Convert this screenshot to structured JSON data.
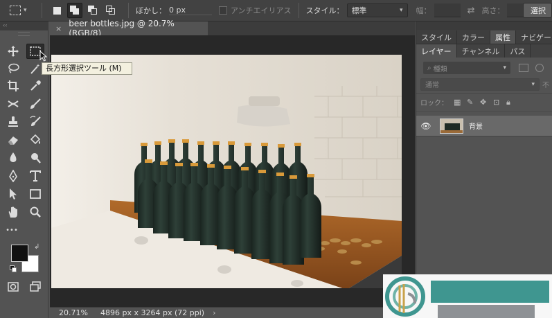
{
  "options_bar": {
    "feather_label": "ぼかし：",
    "feather_value": "0 px",
    "antialias_label": "アンチエイリアス",
    "style_label": "スタイル：",
    "style_value": "標準",
    "width_label": "幅：",
    "height_label": "高さ：",
    "select_button": "選択"
  },
  "toolbar": {
    "collapse_glyph": "‹‹",
    "more_glyph": "•••"
  },
  "tooltip": {
    "text": "長方形選択ツール (M)"
  },
  "document": {
    "tab_title": "beer bottles.jpg @ 20.7% (RGB/8)",
    "close_glyph": "×"
  },
  "status_bar": {
    "zoom": "20.71%",
    "doc_info": "4896 px x 3264 px (72 ppi)",
    "arrow": "›"
  },
  "panels": {
    "tabs_top": [
      "スタイル",
      "カラー",
      "属性",
      "ナビゲータ"
    ],
    "tabs_layers": [
      "レイヤー",
      "チャンネル",
      "パス"
    ],
    "search_placeholder": "種類",
    "blend_mode": "通常",
    "opacity_label": "不",
    "lock_label": "ロック：",
    "layers": [
      {
        "name": "背景"
      }
    ]
  },
  "colors": {
    "foreground": "#111111",
    "background": "#ffffff",
    "watermark_teal": "#3f9690",
    "watermark_gray": "#8e9195"
  }
}
